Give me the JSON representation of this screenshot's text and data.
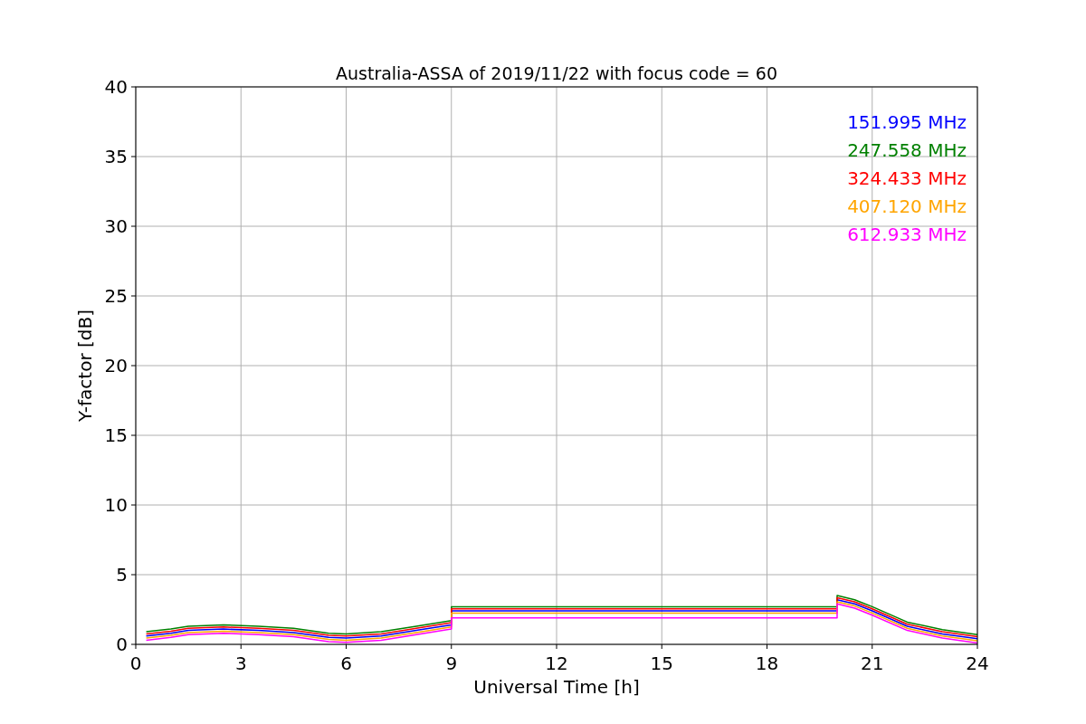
{
  "figure": {
    "chart_data": {
      "type": "line",
      "title": "Australia-ASSA of 2019/11/22 with focus code = 60",
      "xlabel": "Universal Time [h]",
      "ylabel": "Y-factor [dB]",
      "xlim": [
        0,
        24
      ],
      "ylim": [
        0,
        40
      ],
      "xticks": [
        0,
        3,
        6,
        9,
        12,
        15,
        18,
        21,
        24
      ],
      "yticks": [
        0,
        5,
        10,
        15,
        20,
        25,
        30,
        35,
        40
      ],
      "grid": true,
      "x": [
        0.3,
        1,
        1.5,
        2.5,
        3.5,
        4.5,
        5.5,
        6,
        7,
        8,
        9,
        9,
        20,
        20,
        20.5,
        21,
        22,
        23,
        24
      ],
      "series": [
        {
          "name": "151.995 MHz",
          "color": "#0000ff",
          "values": [
            0.6,
            0.8,
            1.0,
            1.1,
            1.0,
            0.85,
            0.5,
            0.45,
            0.6,
            1.0,
            1.4,
            2.4,
            2.4,
            3.2,
            2.9,
            2.4,
            1.3,
            0.75,
            0.4
          ]
        },
        {
          "name": "247.558 MHz",
          "color": "#008000",
          "values": [
            0.9,
            1.1,
            1.3,
            1.4,
            1.3,
            1.15,
            0.8,
            0.75,
            0.9,
            1.3,
            1.7,
            2.7,
            2.7,
            3.5,
            3.2,
            2.7,
            1.6,
            1.05,
            0.7
          ]
        },
        {
          "name": "324.433 MHz",
          "color": "#ff0000",
          "values": [
            0.75,
            0.95,
            1.15,
            1.25,
            1.15,
            1.0,
            0.65,
            0.6,
            0.75,
            1.15,
            1.55,
            2.55,
            2.55,
            3.35,
            3.05,
            2.55,
            1.45,
            0.9,
            0.55
          ]
        },
        {
          "name": "407.120 MHz",
          "color": "#ffa500",
          "values": [
            0.45,
            0.65,
            0.85,
            0.95,
            0.85,
            0.7,
            0.35,
            0.3,
            0.45,
            0.85,
            1.25,
            2.25,
            2.25,
            3.05,
            2.75,
            2.25,
            1.15,
            0.6,
            0.25
          ]
        },
        {
          "name": "612.933 MHz",
          "color": "#ff00ff",
          "values": [
            0.3,
            0.5,
            0.7,
            0.8,
            0.7,
            0.55,
            0.2,
            0.15,
            0.3,
            0.7,
            1.1,
            1.9,
            1.9,
            2.9,
            2.6,
            2.1,
            1.0,
            0.45,
            0.1
          ]
        }
      ]
    }
  }
}
